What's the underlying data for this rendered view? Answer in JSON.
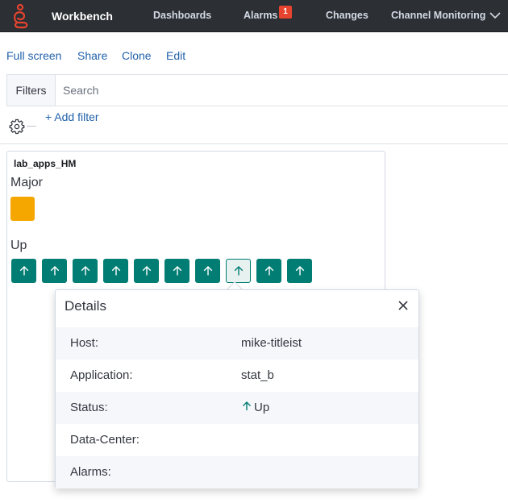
{
  "nav": {
    "title": "Workbench",
    "items": [
      {
        "label": "Dashboards"
      },
      {
        "label": "Alarms",
        "badge": "1"
      },
      {
        "label": "Changes"
      },
      {
        "label": "Channel Monitoring"
      }
    ]
  },
  "actions": {
    "full_screen": "Full screen",
    "share": "Share",
    "clone": "Clone",
    "edit": "Edit"
  },
  "filters": {
    "tab_label": "Filters",
    "search_placeholder": "Search",
    "add_filter": "+ Add filter"
  },
  "panel": {
    "title": "lab_apps_HM",
    "major_label": "Major",
    "major_count": 1,
    "up_label": "Up",
    "up_count": 10,
    "selected_index": 7
  },
  "details": {
    "title": "Details",
    "rows": [
      {
        "key": "Host:",
        "value": "mike-titleist"
      },
      {
        "key": "Application:",
        "value": "stat_b"
      },
      {
        "key": "Status:",
        "value": "Up"
      },
      {
        "key": "Data-Center:",
        "value": ""
      },
      {
        "key": "Alarms:",
        "value": ""
      }
    ]
  },
  "colors": {
    "nav_bg": "#2c2f33",
    "link": "#2162ab",
    "up": "#017d73",
    "major": "#f5a700",
    "badge": "#e7442f",
    "logo": "#e7442f"
  },
  "icons": {
    "logo": "genesys-logo-icon",
    "chevron": "chevron-down-icon",
    "gear": "gear-icon",
    "up": "arrow-up-icon",
    "close": "close-icon"
  }
}
